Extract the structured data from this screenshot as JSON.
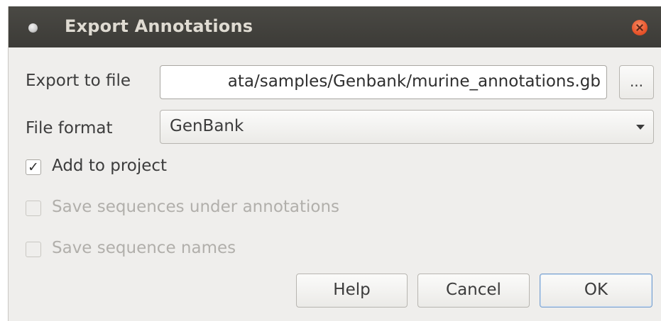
{
  "window": {
    "title": "Export Annotations"
  },
  "form": {
    "export_label": "Export to file",
    "export_value": "ata/samples/Genbank/murine_annotations.gb",
    "browse_label": "...",
    "format_label": "File format",
    "format_selected": "GenBank"
  },
  "options": {
    "add_to_project": {
      "label": "Add to project",
      "checked": true,
      "enabled": true
    },
    "save_sequences": {
      "label": "Save sequences under annotations",
      "checked": false,
      "enabled": false
    },
    "save_names": {
      "label": "Save sequence names",
      "checked": false,
      "enabled": false
    },
    "check_glyph": "✓"
  },
  "buttons": {
    "help": "Help",
    "cancel": "Cancel",
    "ok": "OK"
  },
  "colors": {
    "titlebar": "#3c3b37",
    "close": "#e9552c",
    "dialog_bg": "#efeeec",
    "ok_focus": "#7aa0cd"
  },
  "icons": {
    "title": "window-menu-icon",
    "close": "close-icon",
    "dropdown": "chevron-down-icon",
    "check": "checkmark-icon"
  }
}
